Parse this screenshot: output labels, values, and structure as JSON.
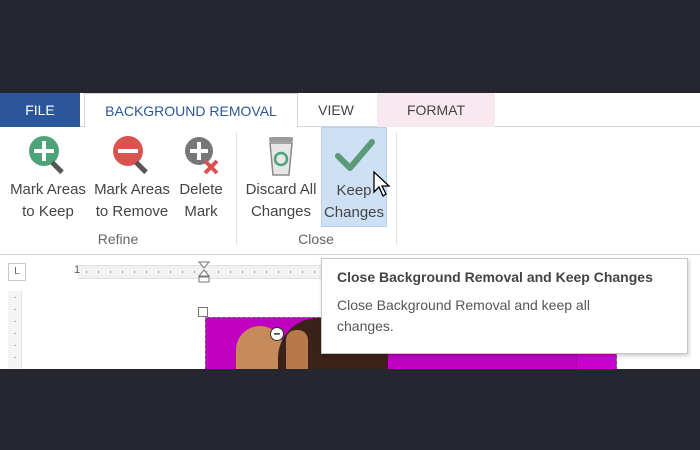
{
  "tabs": {
    "file": "FILE",
    "background_removal": "BACKGROUND REMOVAL",
    "view": "VIEW",
    "format": "FORMAT"
  },
  "ribbon": {
    "mark_keep": {
      "line1": "Mark Areas",
      "line2": "to Keep",
      "icon": "plus-pencil-icon"
    },
    "mark_remove": {
      "line1": "Mark Areas",
      "line2": "to Remove",
      "icon": "minus-pencil-icon"
    },
    "delete_mark": {
      "line1": "Delete",
      "line2": "Mark",
      "icon": "delete-mark-icon"
    },
    "discard_all": {
      "line1": "Discard All",
      "line2": "Changes",
      "icon": "recycle-bin-icon"
    },
    "keep_changes": {
      "line1": "Keep",
      "line2": "Changes",
      "icon": "checkmark-icon"
    },
    "groups": {
      "refine": "Refine",
      "close": "Close"
    }
  },
  "ruler": {
    "corner": "L",
    "number": "1"
  },
  "tooltip": {
    "title": "Close Background Removal and Keep Changes",
    "description": "Close Background Removal and keep all changes."
  },
  "colors": {
    "file_tab": "#2b579a",
    "format_tab": "#f8e8ef",
    "keep_highlight": "#cde0f4",
    "plus_green": "#4fa37a",
    "minus_red": "#d9534f",
    "photo_background": "#c000c0"
  }
}
